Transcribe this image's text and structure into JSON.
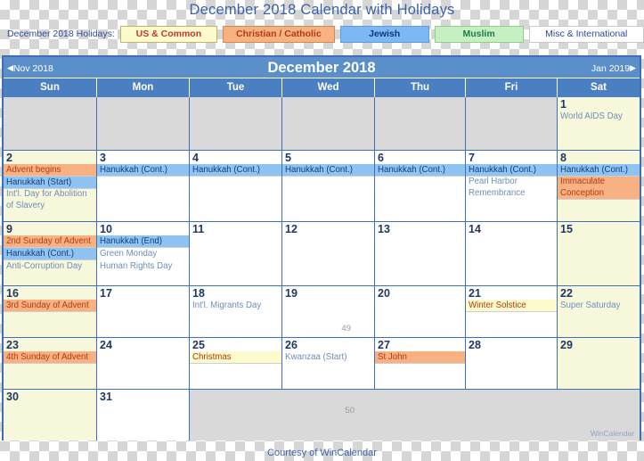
{
  "page_title": "December 2018 Calendar with Holidays",
  "legend": {
    "label": "December 2018 Holidays:",
    "chips": [
      {
        "label": "US & Common",
        "bg": "#fdfbcd",
        "fg": "#c0392b"
      },
      {
        "label": "Christian / Catholic",
        "bg": "#f8b183",
        "fg": "#b23b0f"
      },
      {
        "label": "Jewish",
        "bg": "#7cb8f4",
        "fg": "#10357f"
      },
      {
        "label": "Muslim",
        "bg": "#c6f0c2",
        "fg": "#1f7a46"
      },
      {
        "label": "Misc & International",
        "bg": "#ffffff",
        "fg": "#2a4c9b"
      }
    ]
  },
  "calendar": {
    "month_title": "December 2018",
    "prev_label": "Nov 2018",
    "next_label": "Jan 2019",
    "prev_arrow": "◀",
    "next_arrow": "▶",
    "weekdays": [
      "Sun",
      "Mon",
      "Tue",
      "Wed",
      "Thu",
      "Fri",
      "Sat"
    ],
    "brand_mark": "WinCalendar",
    "week_numbers": {
      "w4": "49",
      "w6": "50"
    },
    "weeks": [
      {
        "days": [
          {
            "num": "",
            "blank": true
          },
          {
            "num": "",
            "blank": true
          },
          {
            "num": "",
            "blank": true
          },
          {
            "num": "",
            "blank": true
          },
          {
            "num": "",
            "blank": true
          },
          {
            "num": "",
            "blank": true
          },
          {
            "num": "1",
            "weekend": true,
            "events": [
              {
                "text": "World AIDS Day",
                "cat": "misc"
              }
            ]
          }
        ]
      },
      {
        "days": [
          {
            "num": "2",
            "weekend": true,
            "events": [
              {
                "text": "Advent begins",
                "cat": "christian"
              },
              {
                "text": "Hanukkah (Start)",
                "cat": "jewish"
              },
              {
                "text": "Int'l. Day for Abolition of Slavery",
                "cat": "misc",
                "wrap": true
              }
            ]
          },
          {
            "num": "3",
            "events": [
              {
                "text": "Hanukkah (Cont.)",
                "cat": "jewish"
              }
            ]
          },
          {
            "num": "4",
            "events": [
              {
                "text": "Hanukkah (Cont.)",
                "cat": "jewish"
              }
            ]
          },
          {
            "num": "5",
            "events": [
              {
                "text": "Hanukkah (Cont.)",
                "cat": "jewish"
              }
            ]
          },
          {
            "num": "6",
            "events": [
              {
                "text": "Hanukkah (Cont.)",
                "cat": "jewish"
              }
            ]
          },
          {
            "num": "7",
            "events": [
              {
                "text": "Hanukkah (Cont.)",
                "cat": "jewish"
              },
              {
                "text": "Pearl Harbor Remembrance",
                "cat": "misc",
                "wrap": true
              }
            ]
          },
          {
            "num": "8",
            "weekend": true,
            "events": [
              {
                "text": "Hanukkah (Cont.)",
                "cat": "jewish"
              },
              {
                "text": "Immaculate Conception",
                "cat": "christian",
                "wrap": true
              }
            ]
          }
        ]
      },
      {
        "days": [
          {
            "num": "9",
            "weekend": true,
            "events": [
              {
                "text": "2nd Sunday of Advent",
                "cat": "christian"
              },
              {
                "text": "Hanukkah (Cont.)",
                "cat": "jewish"
              },
              {
                "text": "Anti-Corruption Day",
                "cat": "misc"
              }
            ]
          },
          {
            "num": "10",
            "events": [
              {
                "text": "Hanukkah (End)",
                "cat": "jewish"
              },
              {
                "text": "Green Monday",
                "cat": "misc"
              },
              {
                "text": "Human Rights Day",
                "cat": "misc"
              }
            ]
          },
          {
            "num": "11",
            "events": []
          },
          {
            "num": "12",
            "events": []
          },
          {
            "num": "13",
            "events": []
          },
          {
            "num": "14",
            "events": []
          },
          {
            "num": "15",
            "weekend": true,
            "events": []
          }
        ]
      },
      {
        "days": [
          {
            "num": "16",
            "weekend": true,
            "events": [
              {
                "text": "3rd Sunday of Advent",
                "cat": "christian"
              }
            ]
          },
          {
            "num": "17",
            "events": []
          },
          {
            "num": "18",
            "events": [
              {
                "text": "Int'l. Migrants Day",
                "cat": "misc"
              }
            ]
          },
          {
            "num": "19",
            "events": [],
            "week_num": "49"
          },
          {
            "num": "20",
            "events": []
          },
          {
            "num": "21",
            "events": [
              {
                "text": "Winter Solstice",
                "cat": "common"
              }
            ]
          },
          {
            "num": "22",
            "weekend": true,
            "events": [
              {
                "text": "Super Saturday",
                "cat": "misc"
              }
            ]
          }
        ]
      },
      {
        "days": [
          {
            "num": "23",
            "weekend": true,
            "events": [
              {
                "text": "4th Sunday of Advent",
                "cat": "christian"
              }
            ]
          },
          {
            "num": "24",
            "events": []
          },
          {
            "num": "25",
            "events": [
              {
                "text": "Christmas",
                "cat": "common"
              }
            ]
          },
          {
            "num": "26",
            "events": [
              {
                "text": "Kwanzaa (Start)",
                "cat": "misc"
              }
            ]
          },
          {
            "num": "27",
            "events": [
              {
                "text": "St John",
                "cat": "christian"
              }
            ]
          },
          {
            "num": "28",
            "events": []
          },
          {
            "num": "29",
            "weekend": true,
            "events": []
          }
        ]
      },
      {
        "days": [
          {
            "num": "30",
            "weekend": true,
            "events": []
          },
          {
            "num": "31",
            "events": []
          },
          {
            "num": "",
            "spanblank": true,
            "week_num": "50"
          }
        ]
      }
    ]
  },
  "footer": {
    "text": "Courtesy of WinCalendar"
  }
}
